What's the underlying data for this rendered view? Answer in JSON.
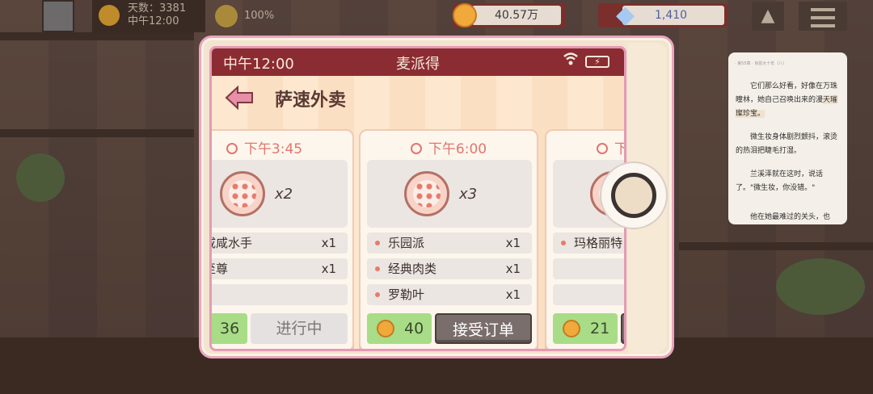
{
  "hud": {
    "day_label": "天数：3381",
    "time": "中午12:00",
    "mood": "100%",
    "coins": "40.57万",
    "gems": "1,410"
  },
  "phone": {
    "status_time": "中午12:00",
    "app_name": "麦派得",
    "page_title": "萨速外卖"
  },
  "orders": [
    {
      "time": "下午3:45",
      "quantity": "x2",
      "items": [
        {
          "name": "咸咸水手",
          "count": "x1"
        },
        {
          "name": "至尊",
          "count": "x1"
        }
      ],
      "reward": "36",
      "action": "进行中"
    },
    {
      "time": "下午6:00",
      "quantity": "x3",
      "items": [
        {
          "name": "乐园派",
          "count": "x1"
        },
        {
          "name": "经典肉类",
          "count": "x1"
        },
        {
          "name": "罗勒叶",
          "count": "x1"
        }
      ],
      "reward": "40",
      "action": "接受订单"
    },
    {
      "time": "下",
      "quantity": "",
      "items": [
        {
          "name": "玛格丽特",
          "count": ""
        }
      ],
      "reward": "21",
      "action": ""
    }
  ],
  "reader": {
    "topline": "· 第55章 · 目前大十年（八）",
    "para1_a": "它们那么好看，好像在万珠瞳林，她自己召唤出来的漫",
    "para1_b": "天璀璨珍宝。",
    "para2": "微生妆身体剧烈颤抖，滚烫的热泪把睫毛打湿。",
    "para3": "兰溪泽就在这时，说话了。\"微生妆，你没错。\"",
    "para4": "他在她最难过的关头，也"
  },
  "colors": {
    "status_bar": "#8b2c33",
    "accept_button": "#7a6e6c",
    "reward_bg": "#a9dc87",
    "time_text": "#e0766f",
    "phone_border": "#e9a6bd"
  }
}
